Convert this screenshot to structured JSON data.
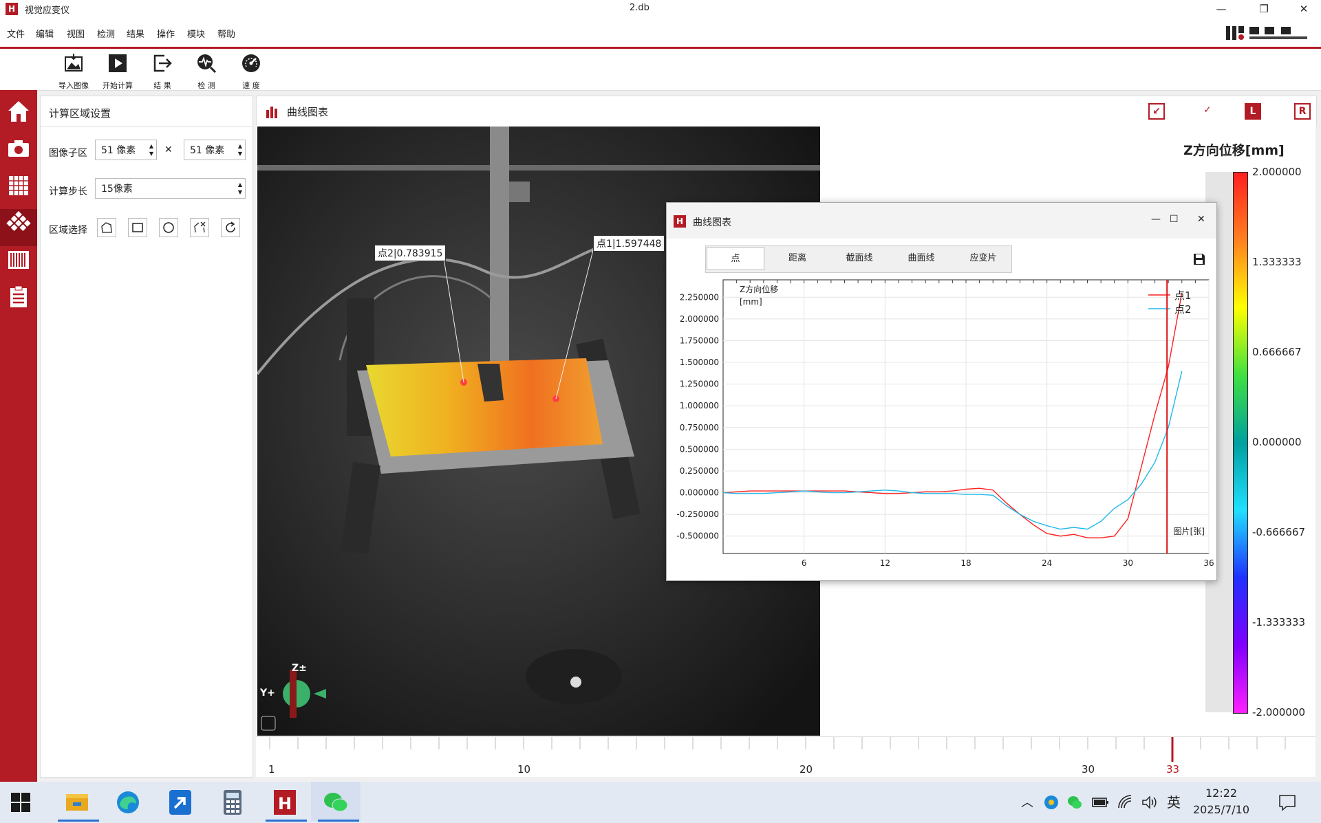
{
  "window": {
    "app_title": "视觉应变仪",
    "doc_title": "2.db",
    "minimize": "—",
    "maximize": "❐",
    "close": "✕"
  },
  "menu": [
    "文件",
    "编辑",
    "视图",
    "检测",
    "结果",
    "操作",
    "模块",
    "帮助"
  ],
  "toolbar": [
    "导入图像",
    "开始计算",
    "结  果",
    "检  测",
    "速  度"
  ],
  "panel": {
    "title": "计算区域设置",
    "subset_label": "图像子区",
    "subset_w": "51 像素",
    "times": "✕",
    "subset_h": "51 像素",
    "step_label": "计算步长",
    "step_value": "15像素",
    "region_label": "区域选择"
  },
  "chart_panel": {
    "title": "曲线图表",
    "buttons": [
      "↙",
      "✓",
      "L",
      "R"
    ]
  },
  "image_labels": {
    "p2": "点2|0.783915",
    "p1": "点1|1.597448",
    "axis_z": "Z±",
    "axis_y": "Y+"
  },
  "colorbar": {
    "title": "Z方向位移[mm]",
    "labels": [
      "2.000000",
      "1.333333",
      "0.666667",
      "0.000000",
      "-0.666667",
      "-1.333333",
      "-2.000000"
    ]
  },
  "timeline": {
    "labels": [
      "1",
      "10",
      "20",
      "30",
      "33"
    ],
    "current": 33
  },
  "popup": {
    "title": "曲线图表",
    "tabs": [
      "点",
      "距离",
      "截面线",
      "曲面线",
      "应变片"
    ],
    "active_tab": "点",
    "min": "—",
    "max": "☐",
    "close": "✕"
  },
  "chart_data": {
    "type": "line",
    "ylabel": "Z方向位移\n[mm]",
    "xlabel": "图片[张]",
    "xlim": [
      0,
      36
    ],
    "ylim": [
      -0.7,
      2.45
    ],
    "xticks": [
      6,
      12,
      18,
      24,
      30,
      36
    ],
    "yticks": [
      -0.5,
      -0.25,
      0,
      0.25,
      0.5,
      0.75,
      1.0,
      1.25,
      1.5,
      1.75,
      2.0,
      2.25
    ],
    "ytick_labels": [
      "-0.500000",
      "-0.250000",
      "0.000000",
      "0.250000",
      "0.500000",
      "0.750000",
      "1.000000",
      "1.250000",
      "1.500000",
      "1.750000",
      "2.000000",
      "2.250000"
    ],
    "cursor_x": 32.9,
    "series": [
      {
        "name": "点1",
        "color": "#ff2020",
        "x": [
          0,
          1,
          2,
          3,
          4,
          5,
          6,
          7,
          8,
          9,
          10,
          11,
          12,
          13,
          14,
          15,
          16,
          17,
          18,
          19,
          20,
          21,
          22,
          23,
          24,
          25,
          26,
          27,
          28,
          29,
          30,
          31,
          32,
          33,
          34
        ],
        "y": [
          0.0,
          0.01,
          0.02,
          0.02,
          0.02,
          0.02,
          0.02,
          0.02,
          0.02,
          0.02,
          0.01,
          0.0,
          -0.01,
          -0.01,
          0.0,
          0.01,
          0.01,
          0.02,
          0.04,
          0.05,
          0.03,
          -0.12,
          -0.25,
          -0.37,
          -0.47,
          -0.5,
          -0.48,
          -0.52,
          -0.52,
          -0.5,
          -0.3,
          0.3,
          0.9,
          1.45,
          2.3
        ]
      },
      {
        "name": "点2",
        "color": "#20b8e8",
        "x": [
          0,
          1,
          2,
          3,
          4,
          5,
          6,
          7,
          8,
          9,
          10,
          11,
          12,
          13,
          14,
          15,
          16,
          17,
          18,
          19,
          20,
          21,
          22,
          23,
          24,
          25,
          26,
          27,
          28,
          29,
          30,
          31,
          32,
          33,
          34
        ],
        "y": [
          0.0,
          -0.01,
          -0.01,
          -0.01,
          0.0,
          0.01,
          0.02,
          0.01,
          0.0,
          0.0,
          0.01,
          0.02,
          0.03,
          0.02,
          0.0,
          -0.01,
          -0.01,
          -0.01,
          -0.02,
          -0.02,
          -0.03,
          -0.15,
          -0.25,
          -0.33,
          -0.38,
          -0.42,
          -0.4,
          -0.42,
          -0.33,
          -0.18,
          -0.08,
          0.1,
          0.35,
          0.75,
          1.4
        ]
      }
    ]
  },
  "taskbar": {
    "time": "12:22",
    "date": "2025/7/10",
    "ime": "英"
  }
}
